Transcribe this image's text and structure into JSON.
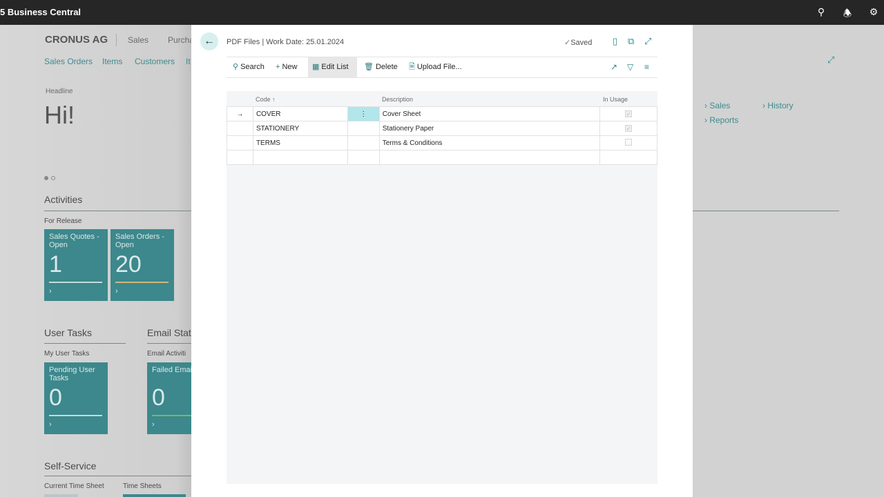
{
  "app": {
    "title": "5 Business Central",
    "icons": [
      "search-icon",
      "bell-icon",
      "gear-icon"
    ]
  },
  "background": {
    "company": "CRONUS AG",
    "menu": [
      "Sales",
      "Purcha"
    ],
    "nav": [
      "Sales Orders",
      "Items",
      "Customers",
      "It"
    ],
    "headline_label": "Headline",
    "headline": "Hi!",
    "activities": "Activities",
    "for_release": "For Release",
    "tiles1": [
      {
        "label": "Sales Quotes - Open",
        "value": "1"
      },
      {
        "label": "Sales Orders - Open",
        "value": "20"
      }
    ],
    "user_tasks": "User Tasks",
    "my_user_tasks": "My User Tasks",
    "tile_pending": {
      "label": "Pending User Tasks",
      "value": "0"
    },
    "email_status": "Email Statu",
    "email_activities": "Email Activiti",
    "tile_failed": {
      "label": "Failed Emails Outbox",
      "value": "0"
    },
    "self_service": "Self-Service",
    "current_time_sheet": "Current Time Sheet",
    "time_sheets": "Time Sheets",
    "links": [
      "Sales",
      "History",
      "Reports"
    ]
  },
  "dialog": {
    "title": "PDF Files | Work Date: 25.01.2024",
    "saved": "Saved",
    "actions": {
      "search": "Search",
      "new": "New",
      "edit_list": "Edit List",
      "delete": "Delete",
      "upload": "Upload File..."
    },
    "columns": {
      "code": "Code",
      "description": "Description",
      "in_usage": "In Usage"
    },
    "rows": [
      {
        "code": "COVER",
        "description": "Cover Sheet",
        "in_usage": true
      },
      {
        "code": "STATIONERY",
        "description": "Stationery Paper",
        "in_usage": true
      },
      {
        "code": "TERMS",
        "description": "Terms & Conditions",
        "in_usage": false
      }
    ]
  }
}
